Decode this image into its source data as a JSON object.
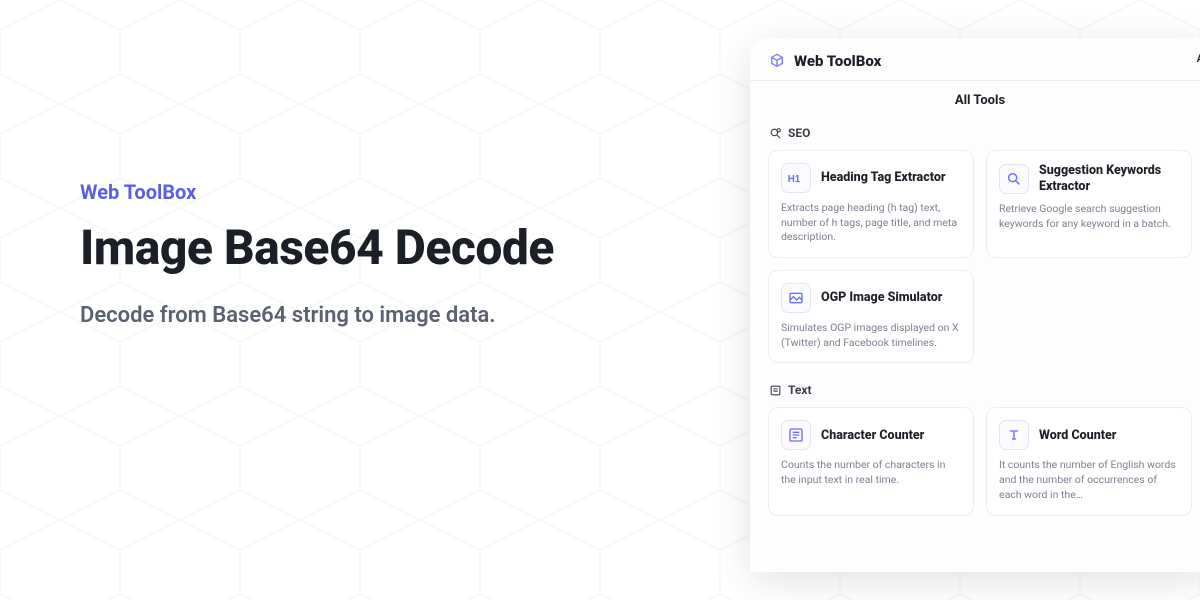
{
  "brand": "Web ToolBox",
  "title": "Image Base64 Decode",
  "subtitle": "Decode from Base64 string to image data.",
  "panel": {
    "brand": "Web ToolBox",
    "tab_label": "All Tools",
    "corner_letter": "A",
    "sections": [
      {
        "name": "SEO",
        "cards": [
          {
            "icon": "h1",
            "title": "Heading Tag Extractor",
            "desc": "Extracts page heading (h tag) text, number of h tags, page title, and meta description."
          },
          {
            "icon": "search",
            "title": "Suggestion Keywords Extractor",
            "desc": "Retrieve Google search suggestion keywords for any keyword in a batch."
          },
          {
            "icon": "image",
            "title": "OGP Image Simulator",
            "desc": "Simulates OGP images displayed on X (Twitter) and Facebook timelines."
          }
        ]
      },
      {
        "name": "Text",
        "cards": [
          {
            "icon": "lines",
            "title": "Character Counter",
            "desc": "Counts the number of characters in the input text in real time."
          },
          {
            "icon": "T",
            "title": "Word Counter",
            "desc": "It counts the number of English words and the number of occurrences of each word in the…"
          }
        ]
      }
    ]
  }
}
